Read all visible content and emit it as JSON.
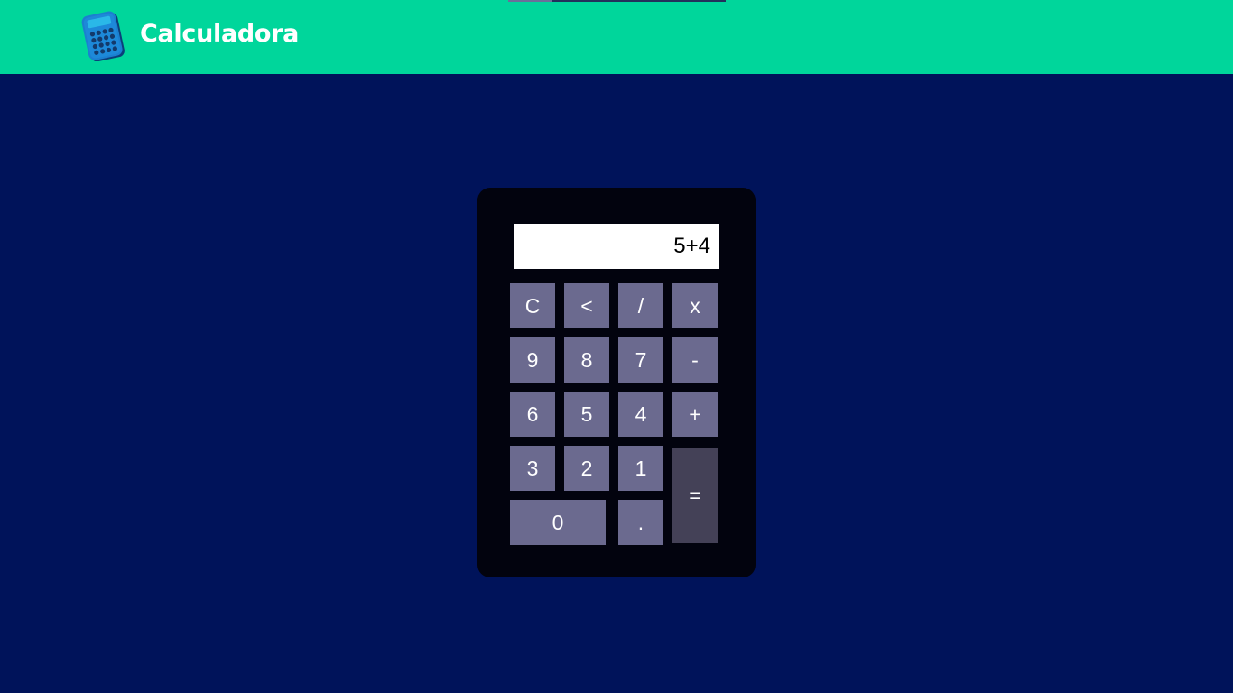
{
  "header": {
    "title": "Calculadora",
    "logo_icon": "calculator-icon",
    "background": "#00d69b"
  },
  "calculator": {
    "display_value": "5+4",
    "keys": {
      "clear": "C",
      "backspace": "<",
      "divide": "/",
      "multiply": "x",
      "nine": "9",
      "eight": "8",
      "seven": "7",
      "minus": "-",
      "six": "6",
      "five": "5",
      "four": "4",
      "plus": "+",
      "three": "3",
      "two": "2",
      "one": "1",
      "equals": "=",
      "zero": "0",
      "decimal": "."
    },
    "colors": {
      "body": "#02030e",
      "key": "#6b6a8f",
      "equals_key": "#444157",
      "page_background": "#00135a"
    }
  }
}
